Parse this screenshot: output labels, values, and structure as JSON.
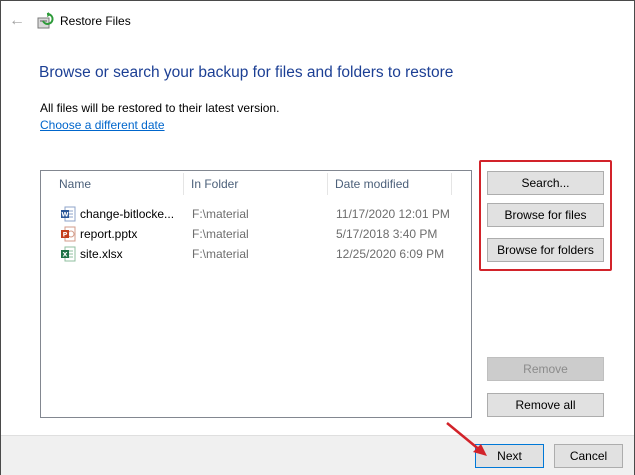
{
  "window": {
    "title": "Restore Files"
  },
  "page": {
    "heading": "Browse or search your backup for files and folders to restore",
    "info": "All files will be restored to their latest version.",
    "date_link": "Choose a different date"
  },
  "file_list": {
    "columns": [
      "Name",
      "In Folder",
      "Date modified"
    ],
    "rows": [
      {
        "name": "change-bitlocke...",
        "folder": "F:\\material",
        "date": "11/17/2020 12:01 PM",
        "icon": "word-icon",
        "color": "#2b5797"
      },
      {
        "name": "report.pptx",
        "folder": "F:\\material",
        "date": "5/17/2018 3:40 PM",
        "icon": "powerpoint-icon",
        "color": "#c43e1c"
      },
      {
        "name": "site.xlsx",
        "folder": "F:\\material",
        "date": "12/25/2020 6:09 PM",
        "icon": "excel-icon",
        "color": "#1e7145"
      }
    ]
  },
  "buttons": {
    "search": "Search...",
    "browse_files": "Browse for files",
    "browse_folders": "Browse for folders",
    "remove": "Remove",
    "remove_all": "Remove all",
    "next": "Next",
    "cancel": "Cancel"
  },
  "colors": {
    "heading": "#1c3f94",
    "link": "#0066cc",
    "annotation": "#d2232a"
  }
}
